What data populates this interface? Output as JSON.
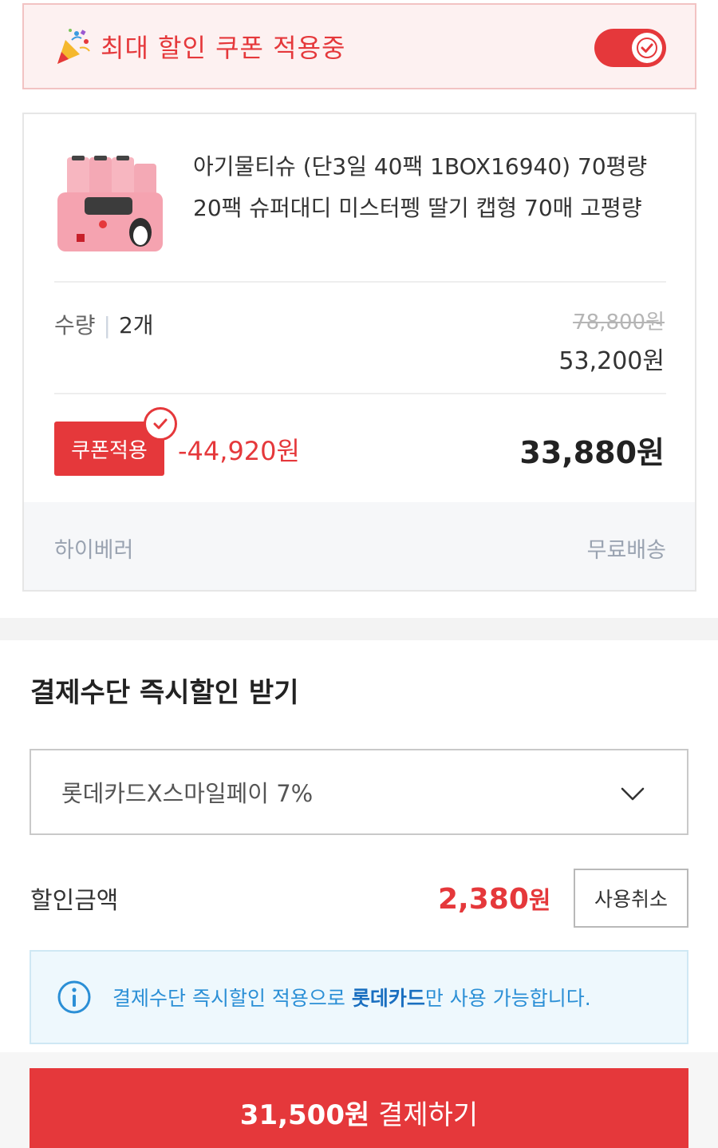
{
  "coupon_banner": {
    "text": "최대 할인 쿠폰 적용중",
    "toggle_on": true
  },
  "product": {
    "title": "아기물티슈 (단3일 40팩 1BOX16940) 70평량 20팩 슈퍼대디 미스터펭 딸기 캡형 70매 고평량",
    "quantity_label": "수량",
    "quantity_value": "2개",
    "original_price": "78,800원",
    "subtotal_price": "53,200원",
    "coupon_button_label": "쿠폰적용",
    "coupon_discount": "-44,920원",
    "final_price": "33,880원",
    "seller": "하이베러",
    "shipping": "무료배송"
  },
  "payment": {
    "title": "결제수단 즉시할인 받기",
    "selected_card": "롯데카드X스마일페이 7%",
    "discount_label": "할인금액",
    "discount_number": "2,380",
    "discount_unit": "원",
    "cancel_label": "사용취소",
    "info_prefix": "결제수단 즉시할인 적용으로 ",
    "info_highlight": "롯데카드",
    "info_suffix": "만 사용 가능합니다."
  },
  "pay_button": {
    "amount": "31,500원",
    "label": " 결제하기"
  },
  "colors": {
    "accent": "#e5383b",
    "info_blue": "#2b8fd6"
  },
  "icons": [
    "party-popper-icon",
    "check-icon",
    "chevron-down-icon",
    "info-icon"
  ]
}
